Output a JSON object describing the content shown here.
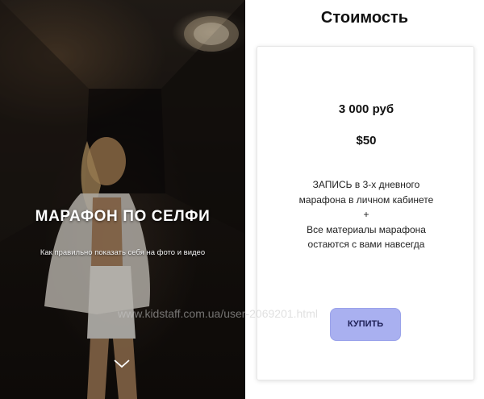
{
  "hero": {
    "title": "МАРАФОН ПО СЕЛФИ",
    "subtitle": "Как правильно показать себя на фото и видео"
  },
  "pricing": {
    "section_title": "Стоимость",
    "price_rub": "3 000 руб",
    "price_usd": "$50",
    "description_lines": [
      "ЗАПИСЬ в 3-х дневного",
      "марафона в личном кабинете",
      "+",
      "Все материалы марафона",
      "остаются с вами навсегда"
    ],
    "buy_label": "КУПИТЬ"
  },
  "watermark": "www.kidstaff.com.ua/user-2069201.html",
  "colors": {
    "button_bg": "#a9b0f0",
    "button_text": "#1d1f55",
    "hero_bg": "#1a1511"
  },
  "icons": {
    "scroll_down": "chevron-down-icon"
  }
}
